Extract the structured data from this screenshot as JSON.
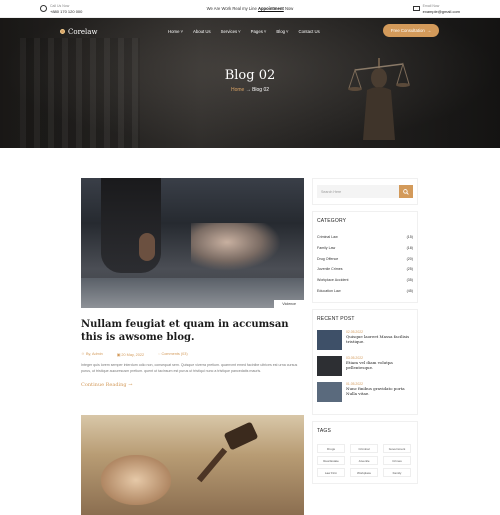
{
  "topbar": {
    "call_label": "Call Us Now",
    "call_number": "+880 170 120 000",
    "announcement_prefix": "We Are Work Real my Line",
    "announcement_link": "Appointment",
    "announcement_suffix": "Now",
    "email_label": "Email Now",
    "email": "example@gmail.com"
  },
  "nav": {
    "logo": "Corelaw",
    "items": [
      "Home",
      "About Us",
      "Services",
      "Pages",
      "Blog",
      "Contact Us"
    ],
    "cta": "Free Consultation"
  },
  "hero": {
    "title": "Blog 02",
    "breadcrumb_home": "Home",
    "breadcrumb_current": "Blog 02"
  },
  "post": {
    "tag": "Violence",
    "title": "Nullam feugiat et quam in accumsan this is awsome blog.",
    "author": "By, Admin",
    "date": "20 May, 2022",
    "comments": "Comments (03)",
    "excerpt": "Integer quis lorem semper interdum odio non, consequat sem. Quisque viverra pretium. quarnvmt emed facinibe ultrices est urna cursus purus, ut tristique aucuresusm pretium. quent ut tacinsum est purus ut tristiqui nunc a tristique pancedatis mauris.",
    "read_more": "Continue Reading"
  },
  "sidebar": {
    "search_placeholder": "Search Here",
    "category_title": "CATEGORY",
    "categories": [
      {
        "name": "Criminal Law",
        "count": "(15)"
      },
      {
        "name": "Family Law",
        "count": "(18)"
      },
      {
        "name": "Drug Offence",
        "count": "(20)"
      },
      {
        "name": "Juvenile Crimes",
        "count": "(25)"
      },
      {
        "name": "Workplace Accident",
        "count": "(35)"
      },
      {
        "name": "Education Law",
        "count": "(45)"
      }
    ],
    "recent_title": "RECENT POST",
    "recent_posts": [
      {
        "date": "02.05.2022",
        "title": "Quisque laoreet Massa facilisis tristique."
      },
      {
        "date": "03.05.2022",
        "title": "Etiam vel diam volutpa pellentesque."
      },
      {
        "date": "01.05.2022",
        "title": "Nunc finibus gravidato porta Nulla vitae."
      }
    ],
    "tags_title": "TAGS",
    "tags": [
      "Drugs",
      "Criminal",
      "Government",
      "Real Estate",
      "Juvenile",
      "Crimes",
      "Law Firm",
      "Workplace",
      "Family"
    ]
  }
}
